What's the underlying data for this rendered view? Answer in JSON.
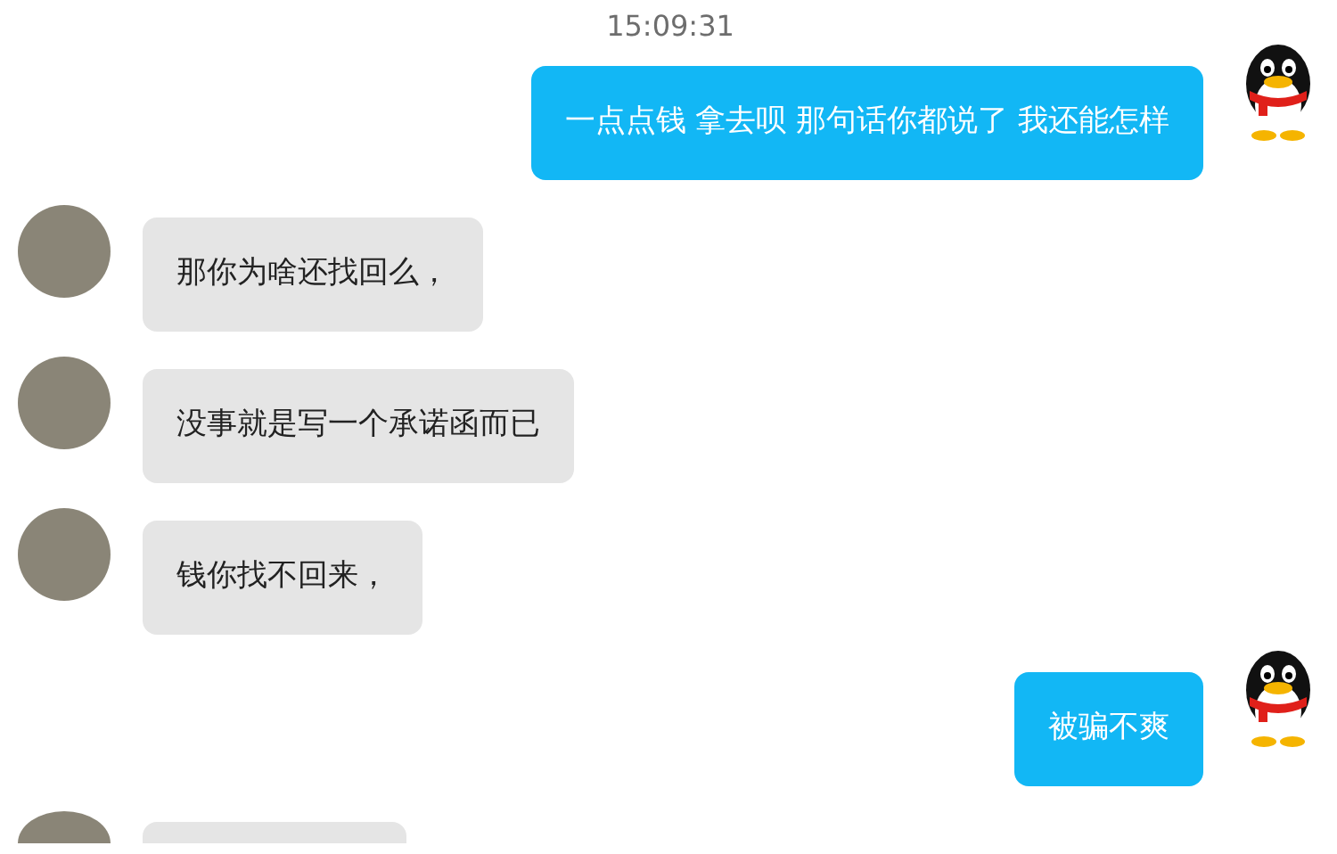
{
  "timestamp": "15:09:31",
  "messages": [
    {
      "kind": "outgoing",
      "text": "一点点钱 拿去呗 那句话你都说了 我还能怎样"
    },
    {
      "kind": "incoming",
      "text": "那你为啥还找回么，"
    },
    {
      "kind": "incoming",
      "text": "没事就是写一个承诺函而已"
    },
    {
      "kind": "incoming",
      "text": "钱你找不回来，"
    },
    {
      "kind": "outgoing",
      "text": "被骗不爽"
    },
    {
      "kind": "incoming"
    }
  ]
}
